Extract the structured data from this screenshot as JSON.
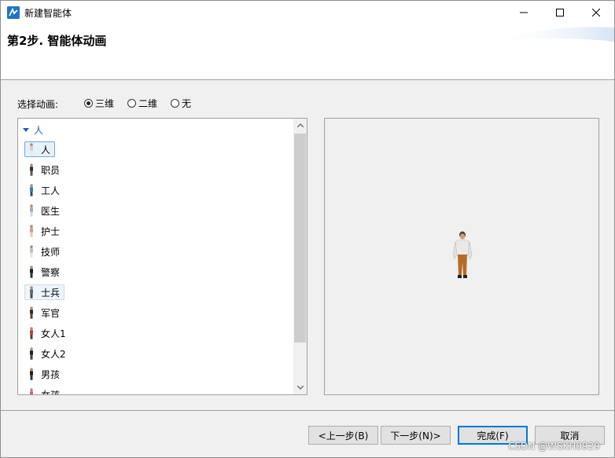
{
  "window": {
    "title": "新建智能体",
    "minimize_icon": "minimize-icon",
    "maximize_icon": "maximize-icon",
    "close_icon": "close-icon"
  },
  "header": {
    "step_title": "第2步. 智能体动画"
  },
  "animation_option": {
    "label": "选择动画:",
    "options": [
      {
        "label": "三维",
        "checked": true
      },
      {
        "label": "二维",
        "checked": false
      },
      {
        "label": "无",
        "checked": false
      }
    ]
  },
  "tree": {
    "group_label": "人",
    "items": [
      {
        "label": "人",
        "state": "selected",
        "colors": [
          "#d0d0d0",
          "#e8e8e8"
        ]
      },
      {
        "label": "职员",
        "state": "",
        "colors": [
          "#333333",
          "#555555"
        ]
      },
      {
        "label": "工人",
        "state": "",
        "colors": [
          "#3a7ab8",
          "#2a4a6a"
        ]
      },
      {
        "label": "医生",
        "state": "",
        "colors": [
          "#9ab0b8",
          "#cfd8dc"
        ]
      },
      {
        "label": "护士",
        "state": "",
        "colors": [
          "#c8a08c",
          "#e0c8bc"
        ]
      },
      {
        "label": "技师",
        "state": "",
        "colors": [
          "#c0c0c0",
          "#e0e0e0"
        ]
      },
      {
        "label": "警察",
        "state": "",
        "colors": [
          "#202020",
          "#303030"
        ]
      },
      {
        "label": "士兵",
        "state": "hover",
        "colors": [
          "#6a6a6a",
          "#4a4a4a"
        ]
      },
      {
        "label": "军官",
        "state": "",
        "colors": [
          "#3a2a20",
          "#5a4030"
        ]
      },
      {
        "label": "女人1",
        "state": "",
        "colors": [
          "#c04040",
          "#404040"
        ]
      },
      {
        "label": "女人2",
        "state": "",
        "colors": [
          "#202020",
          "#404040"
        ]
      },
      {
        "label": "男孩",
        "state": "",
        "colors": [
          "#202020",
          "#303030"
        ]
      },
      {
        "label": "女孩",
        "state": "",
        "colors": [
          "#d06070",
          "#804050"
        ]
      }
    ]
  },
  "preview": {
    "shirt_color": "#e9e9e9",
    "pants_color": "#b86a2a",
    "hair_color": "#5a4030"
  },
  "footer": {
    "prev_label": "<上一步(B)",
    "next_label": "下一步(N)>",
    "finish_label": "完成(F)",
    "cancel_label": "取消"
  },
  "watermark": "CSDN @WSKH0929"
}
